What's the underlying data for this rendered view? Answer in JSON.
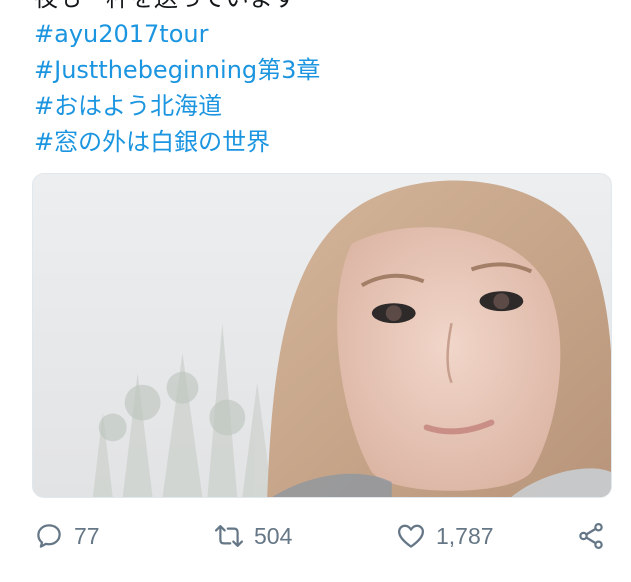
{
  "tweet": {
    "partial_first_line": "夜も一杯を送っています",
    "hashtags": [
      "#ayu2017tour",
      "#Justthebeginning第3章",
      "#おはよう北海道",
      "#窓の外は白銀の世界"
    ]
  },
  "media": {
    "description_icon": "photo-image",
    "colors": {
      "sky": "#ecedf0",
      "hair": "#c9a98c",
      "skin": "#e8cbbd"
    }
  },
  "actions": {
    "reply": {
      "icon": "reply-icon",
      "count": "77"
    },
    "retweet": {
      "icon": "retweet-icon",
      "count": "504"
    },
    "like": {
      "icon": "heart-icon",
      "count": "1,787"
    },
    "share": {
      "icon": "share-icon"
    }
  },
  "colors": {
    "hashtag": "#1b95e0",
    "action": "#657786",
    "text": "#14171a"
  }
}
